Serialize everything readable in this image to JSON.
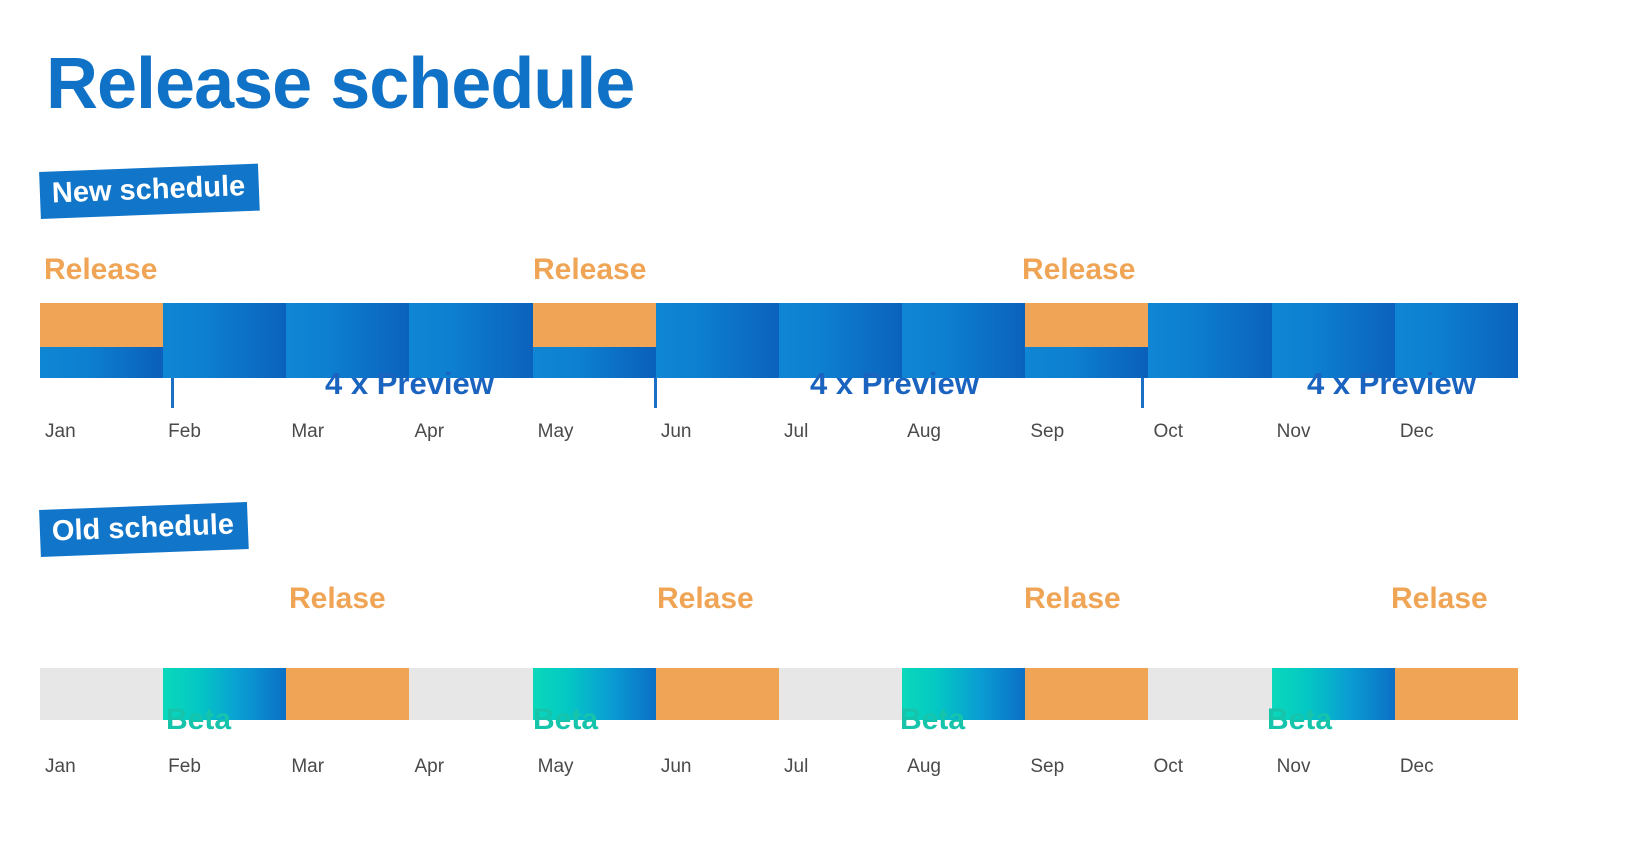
{
  "page": {
    "title": "Release schedule",
    "title_color": "#1072c6",
    "background": "#ffffff"
  },
  "colors": {
    "brand_blue": "#1072c6",
    "badge_blue": "#1175c9",
    "release_orange": "#efa555",
    "beta_teal": "#16c4ac",
    "preview_blue": "#1a64bf",
    "track_gray": "#e7e7e7",
    "month_label": "#4a4a4a"
  },
  "months": [
    "Jan",
    "Feb",
    "Mar",
    "Apr",
    "May",
    "Jun",
    "Jul",
    "Aug",
    "Sep",
    "Oct",
    "Nov",
    "Dec"
  ],
  "new_schedule": {
    "badge_label": "New schedule",
    "release_labels": [
      "Release",
      "Release",
      "Release"
    ],
    "preview_labels": [
      "4 x Preview",
      "4 x Preview",
      "4 x Preview"
    ],
    "segments": [
      {
        "month": "Jan",
        "kind": "release"
      },
      {
        "month": "Feb",
        "kind": "preview"
      },
      {
        "month": "Mar",
        "kind": "preview"
      },
      {
        "month": "Apr",
        "kind": "preview"
      },
      {
        "month": "May",
        "kind": "release"
      },
      {
        "month": "Jun",
        "kind": "preview"
      },
      {
        "month": "Jul",
        "kind": "preview"
      },
      {
        "month": "Aug",
        "kind": "preview"
      },
      {
        "month": "Sep",
        "kind": "release"
      },
      {
        "month": "Oct",
        "kind": "preview"
      },
      {
        "month": "Nov",
        "kind": "preview"
      },
      {
        "month": "Dec",
        "kind": "preview"
      }
    ]
  },
  "old_schedule": {
    "badge_label": "Old schedule",
    "release_labels": [
      "Relase",
      "Relase",
      "Relase",
      "Relase"
    ],
    "beta_labels": [
      "Beta",
      "Beta",
      "Beta",
      "Beta"
    ],
    "segments": [
      {
        "month": "Jan",
        "kind": "empty"
      },
      {
        "month": "Feb",
        "kind": "beta"
      },
      {
        "month": "Mar",
        "kind": "release"
      },
      {
        "month": "Apr",
        "kind": "empty"
      },
      {
        "month": "May",
        "kind": "beta"
      },
      {
        "month": "Jun",
        "kind": "release"
      },
      {
        "month": "Jul",
        "kind": "empty"
      },
      {
        "month": "Aug",
        "kind": "beta"
      },
      {
        "month": "Sep",
        "kind": "release"
      },
      {
        "month": "Oct",
        "kind": "empty"
      },
      {
        "month": "Nov",
        "kind": "beta"
      },
      {
        "month": "Dec",
        "kind": "release"
      }
    ]
  },
  "chart_data": {
    "type": "table",
    "title": "Release schedule",
    "xlabel": "",
    "ylabel": "",
    "categories": [
      "Jan",
      "Feb",
      "Mar",
      "Apr",
      "May",
      "Jun",
      "Jul",
      "Aug",
      "Sep",
      "Oct",
      "Nov",
      "Dec"
    ],
    "series": [
      {
        "name": "New schedule",
        "values": [
          "Release",
          "Preview",
          "Preview",
          "Preview",
          "Release",
          "Preview",
          "Preview",
          "Preview",
          "Release",
          "Preview",
          "Preview",
          "Preview"
        ]
      },
      {
        "name": "Old schedule",
        "values": [
          "",
          "Beta",
          "Relase",
          "",
          "Beta",
          "Relase",
          "",
          "Beta",
          "Relase",
          "",
          "Beta",
          "Relase"
        ]
      }
    ],
    "annotations": [
      {
        "text": "Release",
        "series": "New schedule",
        "at": "Jan"
      },
      {
        "text": "Release",
        "series": "New schedule",
        "at": "May"
      },
      {
        "text": "Release",
        "series": "New schedule",
        "at": "Sep"
      },
      {
        "text": "4 x Preview",
        "series": "New schedule",
        "span": "Feb-May"
      },
      {
        "text": "4 x Preview",
        "series": "New schedule",
        "span": "Jun-Sep"
      },
      {
        "text": "4 x Preview",
        "series": "New schedule",
        "span": "Oct-Dec"
      },
      {
        "text": "Beta",
        "series": "Old schedule",
        "at": "Feb"
      },
      {
        "text": "Relase",
        "series": "Old schedule",
        "at": "Mar"
      },
      {
        "text": "Beta",
        "series": "Old schedule",
        "at": "May"
      },
      {
        "text": "Relase",
        "series": "Old schedule",
        "at": "Jun"
      },
      {
        "text": "Beta",
        "series": "Old schedule",
        "at": "Aug"
      },
      {
        "text": "Relase",
        "series": "Old schedule",
        "at": "Sep"
      },
      {
        "text": "Beta",
        "series": "Old schedule",
        "at": "Nov"
      },
      {
        "text": "Relase",
        "series": "Old schedule",
        "at": "Dec"
      }
    ],
    "legend": [],
    "grid": false
  }
}
